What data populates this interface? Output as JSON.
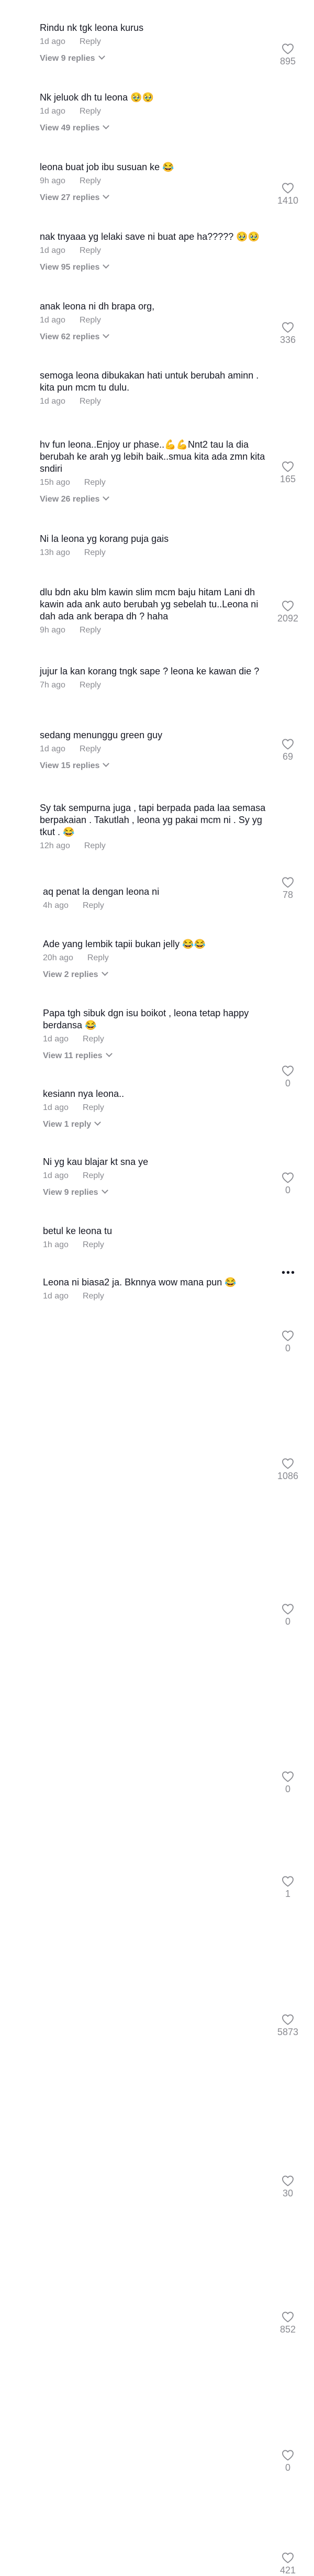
{
  "comments": [
    {
      "text": "Rindu nk tgk leona kurus",
      "time": "1d ago",
      "reply": "Reply",
      "likes": "895",
      "replies": "View 9 replies"
    },
    {
      "text": "Nk jeluok dh tu leona 🥹🥹",
      "time": "1d ago",
      "reply": "Reply",
      "likes": "1410",
      "replies": "View 49 replies"
    },
    {
      "text": "leona buat job ibu susuan ke 😂",
      "time": "9h ago",
      "reply": "Reply",
      "likes": "336",
      "replies": "View 27 replies"
    },
    {
      "text": "nak tnyaaa yg lelaki save ni buat ape ha????? 🥹🥹",
      "time": "1d ago",
      "reply": "Reply",
      "likes": "165",
      "replies": "View 95 replies"
    },
    {
      "text": "anak leona ni dh brapa org,",
      "time": "1d ago",
      "reply": "Reply",
      "likes": "2092",
      "replies": "View 62 replies"
    },
    {
      "text": "semoga leona dibukakan hati untuk berubah aminn . kita pun mcm tu dulu.",
      "time": "1d ago",
      "reply": "Reply",
      "likes": "69",
      "replies": ""
    },
    {
      "text": "hv fun leona..Enjoy ur phase..💪💪Nnt2 tau la dia berubah ke arah yg lebih baik..smua kita ada zmn kita sndiri",
      "time": "15h ago",
      "reply": "Reply",
      "likes": "78",
      "replies": "View 26 replies"
    },
    {
      "text": "Ni la leona yg korang puja gais",
      "time": "13h ago",
      "reply": "Reply",
      "likes": "0",
      "replies": ""
    },
    {
      "text": "dlu bdn aku blm kawin slim mcm baju hitam Lani dh kawin ada ank auto berubah yg sebelah tu..Leona ni dah ada ank berapa dh ? haha",
      "time": "9h ago",
      "reply": "Reply",
      "likes": "0",
      "replies": ""
    },
    {
      "text": "jujur la kan korang tngk sape ? leona ke kawan die ?",
      "time": "7h ago",
      "reply": "Reply",
      "likes": "0",
      "replies": ""
    },
    {
      "text": "sedang menunggu green guy",
      "time": "1d ago",
      "reply": "Reply",
      "likes": "1086",
      "replies": "View 15 replies"
    },
    {
      "text": "Sy tak sempurna juga , tapi berpada pada laa semasa berpakaian . Takutlah , leona yg pakai mcm ni . Sy yg tkut . 😂",
      "time": "12h ago",
      "reply": "Reply",
      "likes": "0",
      "replies": ""
    },
    {
      "text": "aq penat la dengan leona ni",
      "time": "4h ago",
      "reply": "Reply",
      "likes": "0",
      "replies": ""
    },
    {
      "text": "Ade yang lembik tapii bukan jelly 😂😂",
      "time": "20h ago",
      "reply": "Reply",
      "likes": "1",
      "replies": "View 2 replies"
    },
    {
      "text": "Papa tgh sibuk dgn isu boikot , leona tetap happy berdansa 😂",
      "time": "1d ago",
      "reply": "Reply",
      "likes": "5873",
      "replies": "View 11 replies"
    },
    {
      "text": "kesiann nya leona..",
      "time": "1d ago",
      "reply": "Reply",
      "likes": "30",
      "replies": "View 1 reply"
    },
    {
      "text": "Ni yg kau blajar kt sna ye",
      "time": "1d ago",
      "reply": "Reply",
      "likes": "852",
      "replies": "View 9 replies"
    },
    {
      "text": "betul ke leona tu",
      "time": "1h ago",
      "reply": "Reply",
      "likes": "0",
      "replies": ""
    },
    {
      "text": "Leona ni biasa2 ja. Bknnya wow mana pun 😂",
      "time": "1d ago",
      "reply": "Reply",
      "likes": "421",
      "replies": ""
    }
  ],
  "icons": {
    "like": "heart-outline-icon",
    "more": "more-options-icon"
  },
  "more_glyph": "•••",
  "colors": {
    "text": "#161823",
    "secondary": "#8a8b91",
    "background": "#ffffff"
  }
}
